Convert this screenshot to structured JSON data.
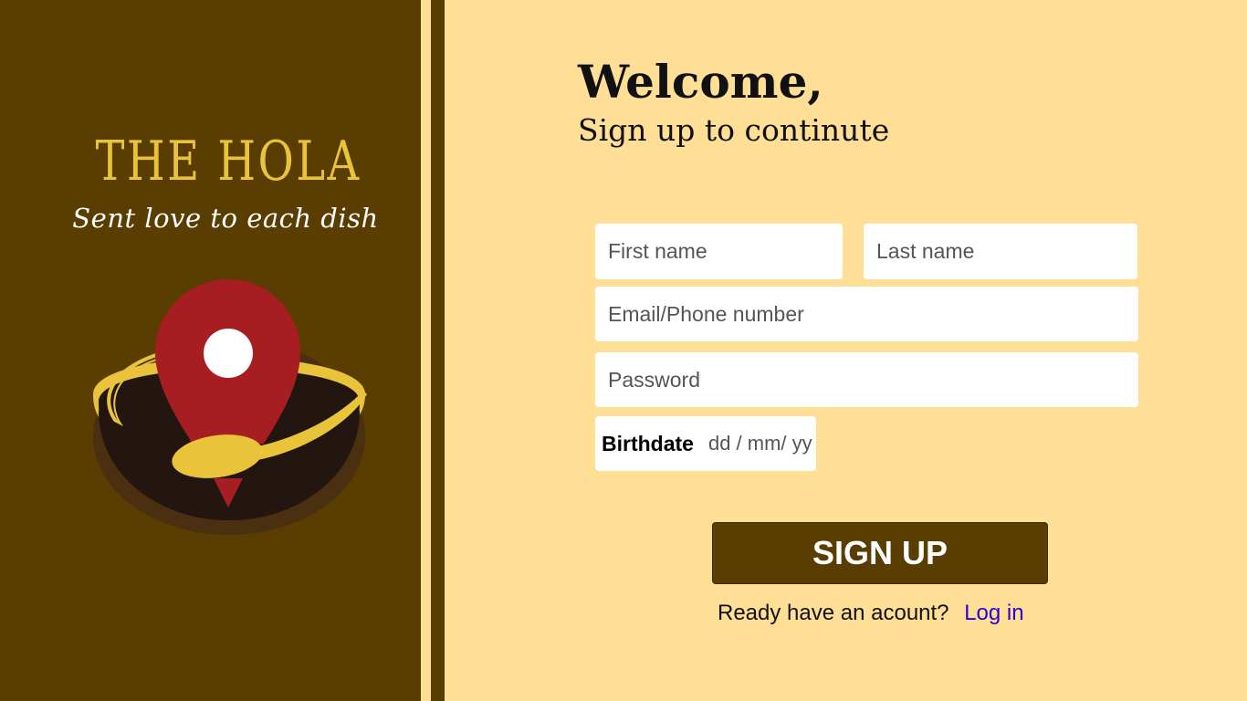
{
  "brand": {
    "name": "THE HOLA",
    "tagline": "Sent love to each dish"
  },
  "logo_icon": "map-pin-in-bowl-with-spoon-icon",
  "welcome": {
    "title": "Welcome,",
    "subtitle": "Sign up to continute"
  },
  "form": {
    "first_name_placeholder": "First name",
    "last_name_placeholder": "Last name",
    "email_placeholder": "Email/Phone number",
    "password_placeholder": "Password",
    "birthdate_label": "Birthdate",
    "birthdate_placeholder": "dd / mm/ yy",
    "signup_label": "SIGN UP"
  },
  "login": {
    "prompt": "Ready have an acount?",
    "link_label": "Log in"
  },
  "colors": {
    "brand_brown": "#5A3D00",
    "background_cream": "#FFDF96",
    "brand_gold": "#E9C43A",
    "pin_red": "#A61E22",
    "bowl_dark": "#231510",
    "link_blue": "#2A00D5"
  }
}
